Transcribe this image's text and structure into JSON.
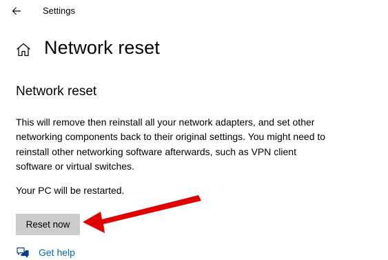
{
  "window": {
    "title": "Settings"
  },
  "page": {
    "title": "Network reset"
  },
  "section": {
    "heading": "Network reset",
    "description": "This will remove then reinstall all your network adapters, and set other networking components back to their original settings. You might need to reinstall other networking software afterwards, such as VPN client software or virtual switches.",
    "restart_note": "Your PC will be restarted."
  },
  "actions": {
    "reset_label": "Reset now",
    "help_label": "Get help"
  },
  "icons": {
    "back": "back-arrow-icon",
    "home": "home-icon",
    "help": "help-chat-icon",
    "annotation": "red-annotation-arrow"
  },
  "colors": {
    "button_bg": "#cccccc",
    "link": "#0067b8",
    "annotation_arrow": "#e00000"
  }
}
